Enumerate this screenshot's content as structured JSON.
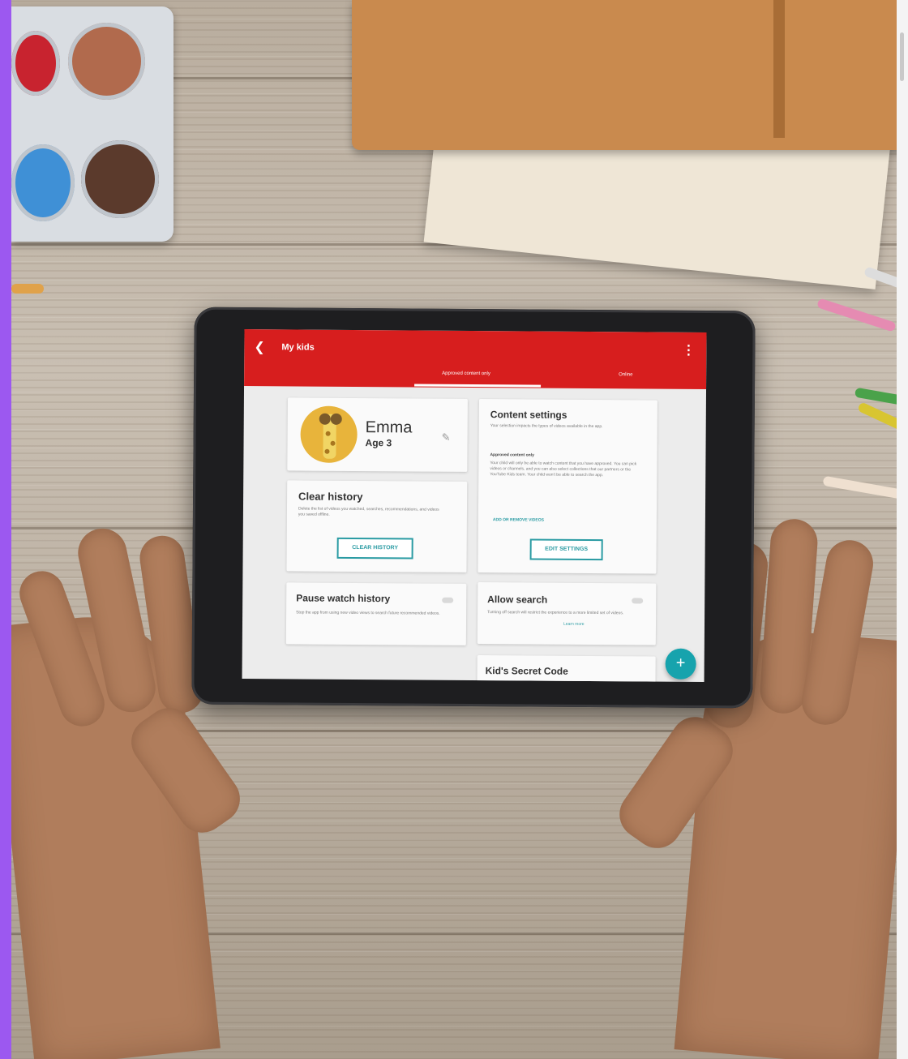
{
  "app": {
    "header_title": "My kids",
    "tabs": [
      "Approved content only",
      "Online"
    ],
    "back_icon": "arrow-back-icon",
    "menu_icon": "more-vert-icon"
  },
  "profile": {
    "name": "Emma",
    "age": "Age 3",
    "edit_icon": "pencil-icon"
  },
  "clear_history": {
    "title": "Clear history",
    "description": "Delete the list of videos you watched, searches, recommendations, and videos you saved offline.",
    "button": "CLEAR HISTORY"
  },
  "pause_watch": {
    "title": "Pause watch history",
    "description": "Stop the app from using new video views to search future recommended videos."
  },
  "content_settings": {
    "title": "Content settings",
    "description": "Your selection impacts the types of videos available in the app.",
    "subheading": "Approved content only",
    "subdescription": "Your child will only be able to watch content that you have approved. You can pick videos or channels, and you can also select collections that our partners or the YouTube Kids team. Your child won't be able to search the app.",
    "link": "ADD OR REMOVE VIDEOS",
    "button": "EDIT SETTINGS"
  },
  "allow_search": {
    "title": "Allow search",
    "description": "Turning off search will restrict the experience to a more limited set of videos.",
    "link": "Learn more"
  },
  "secret_code": {
    "title": "Kid's Secret Code"
  },
  "fab": {
    "label": "+"
  },
  "colors": {
    "appbar": "#d71e1e",
    "accent": "#17a3ad",
    "side_bar": "#9c58f0"
  }
}
